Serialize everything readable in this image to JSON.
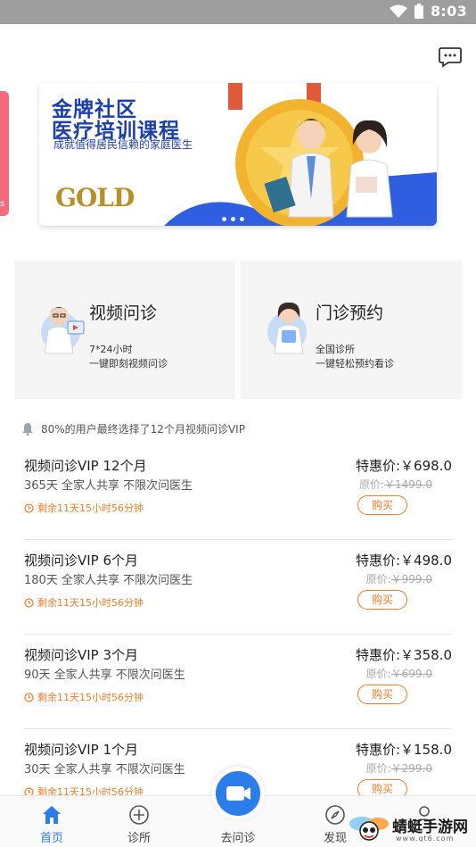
{
  "status_bar": {
    "time": "8:03"
  },
  "banner": {
    "line1": "金牌社区",
    "line2": "医疗培训课程",
    "line3": "成就值得居民信赖的家庭医生",
    "logo": "GOLD"
  },
  "side_card_label": "s",
  "services": [
    {
      "title": "视频问诊",
      "line1": "7*24小时",
      "line2": "一键即刻视频问诊"
    },
    {
      "title": "门诊预约",
      "line1": "全国诊所",
      "line2": "一键轻松预约看诊"
    }
  ],
  "notice": "80%的用户最终选择了12个月视频问诊VIP",
  "plans": [
    {
      "name": "视频问诊VIP  12个月",
      "desc": "365天 全家人共享 不限次问医生",
      "timer": "剩余11天15小时56分钟",
      "price": "特惠价:￥698.0",
      "orig_label": "原价:",
      "orig_price": "￥1499.0",
      "buy": "购买"
    },
    {
      "name": "视频问诊VIP  6个月",
      "desc": "180天 全家人共享 不限次问医生",
      "timer": "剩余11天15小时56分钟",
      "price": "特惠价:￥498.0",
      "orig_label": "原价:",
      "orig_price": "￥999.0",
      "buy": "购买"
    },
    {
      "name": "视频问诊VIP  3个月",
      "desc": "90天 全家人共享 不限次问医生",
      "timer": "剩余11天15小时56分钟",
      "price": "特惠价:￥358.0",
      "orig_label": "原价:",
      "orig_price": "￥699.0",
      "buy": "购买"
    },
    {
      "name": "视频问诊VIP  1个月",
      "desc": "30天 全家人共享 不限次问医生",
      "timer": "剩余11天15小时56分钟",
      "price": "特惠价:￥158.0",
      "orig_label": "原价:",
      "orig_price": "￥299.0",
      "buy": "购买"
    }
  ],
  "tabbar": {
    "home": "首页",
    "clinic": "诊所",
    "consult": "去问诊",
    "discover": "发现"
  },
  "watermark": {
    "title": "蜻蜓手游网",
    "url": "www.qt6.com"
  },
  "colors": {
    "accent": "#2b7de9",
    "orange": "#f07d2c",
    "banner_blue": "#1d3fa8"
  }
}
